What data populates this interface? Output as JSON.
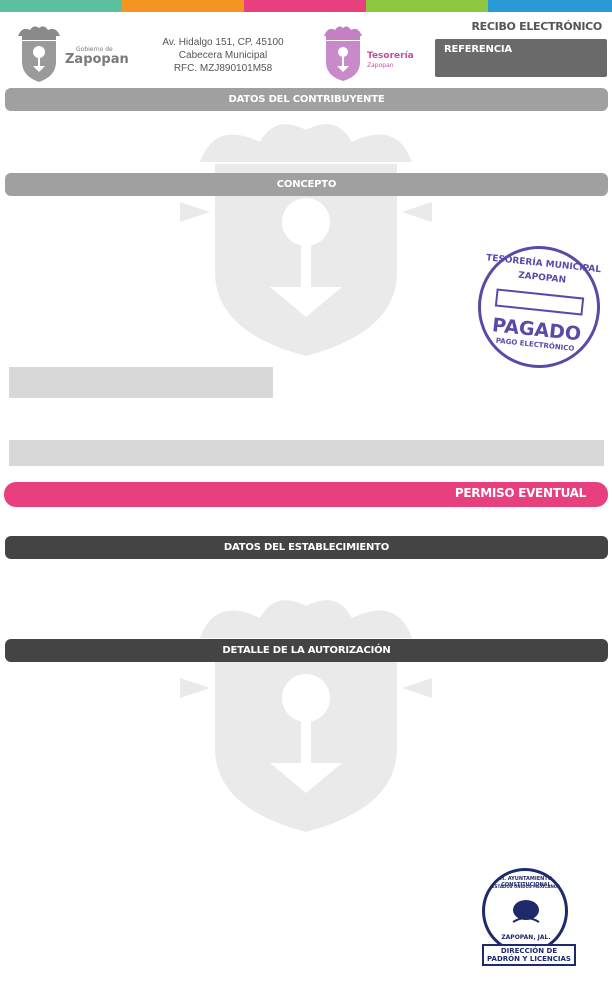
{
  "header": {
    "top_bands": [
      "#5bc0a0",
      "#f39423",
      "#e8407f",
      "#8dc63f",
      "#2a9ad6"
    ],
    "zapopan_small": "Gobierno de",
    "zapopan_name": "Zapopan",
    "address": [
      "Av. Hidalgo 151, CP. 45100",
      "Cabecera Municipal",
      "RFC. MZJ890101M58"
    ],
    "tesoreria_name": "Tesorería",
    "tesoreria_sub": "Zapopan",
    "receipt_title": "RECIBO ELECTRÓNICO",
    "reference_label": "REFERENCIA"
  },
  "sections": {
    "contribuyente": "DATOS DEL CONTRIBUYENTE",
    "concepto": "CONCEPTO",
    "permiso": "PERMISO EVENTUAL",
    "establecimiento": "DATOS DEL ESTABLECIMIENTO",
    "autorizacion": "DETALLE DE LA AUTORIZACIÓN"
  },
  "stamp_paid": {
    "top": "TESORERÍA MUNICIPAL",
    "city": "ZAPOPAN",
    "main": "PAGADO",
    "sub": "PAGO ELECTRÓNICO"
  },
  "stamp_padron": {
    "ring": "H. AYUNTAMIENTO CONSTITUCIONAL",
    "ring2": "ESTADOS UNIDOS MEXICANOS",
    "city": "ZAPOPAN, JAL.",
    "line1": "DIRECCIÓN DE",
    "line2": "PADRÓN Y LICENCIAS"
  },
  "colors": {
    "gray_bar": "#a0a0a0",
    "dark_bar": "#444444",
    "magenta": "#e8407f",
    "stamp_purple": "#5a4aa8",
    "stamp_navy": "#1f2a6b"
  }
}
